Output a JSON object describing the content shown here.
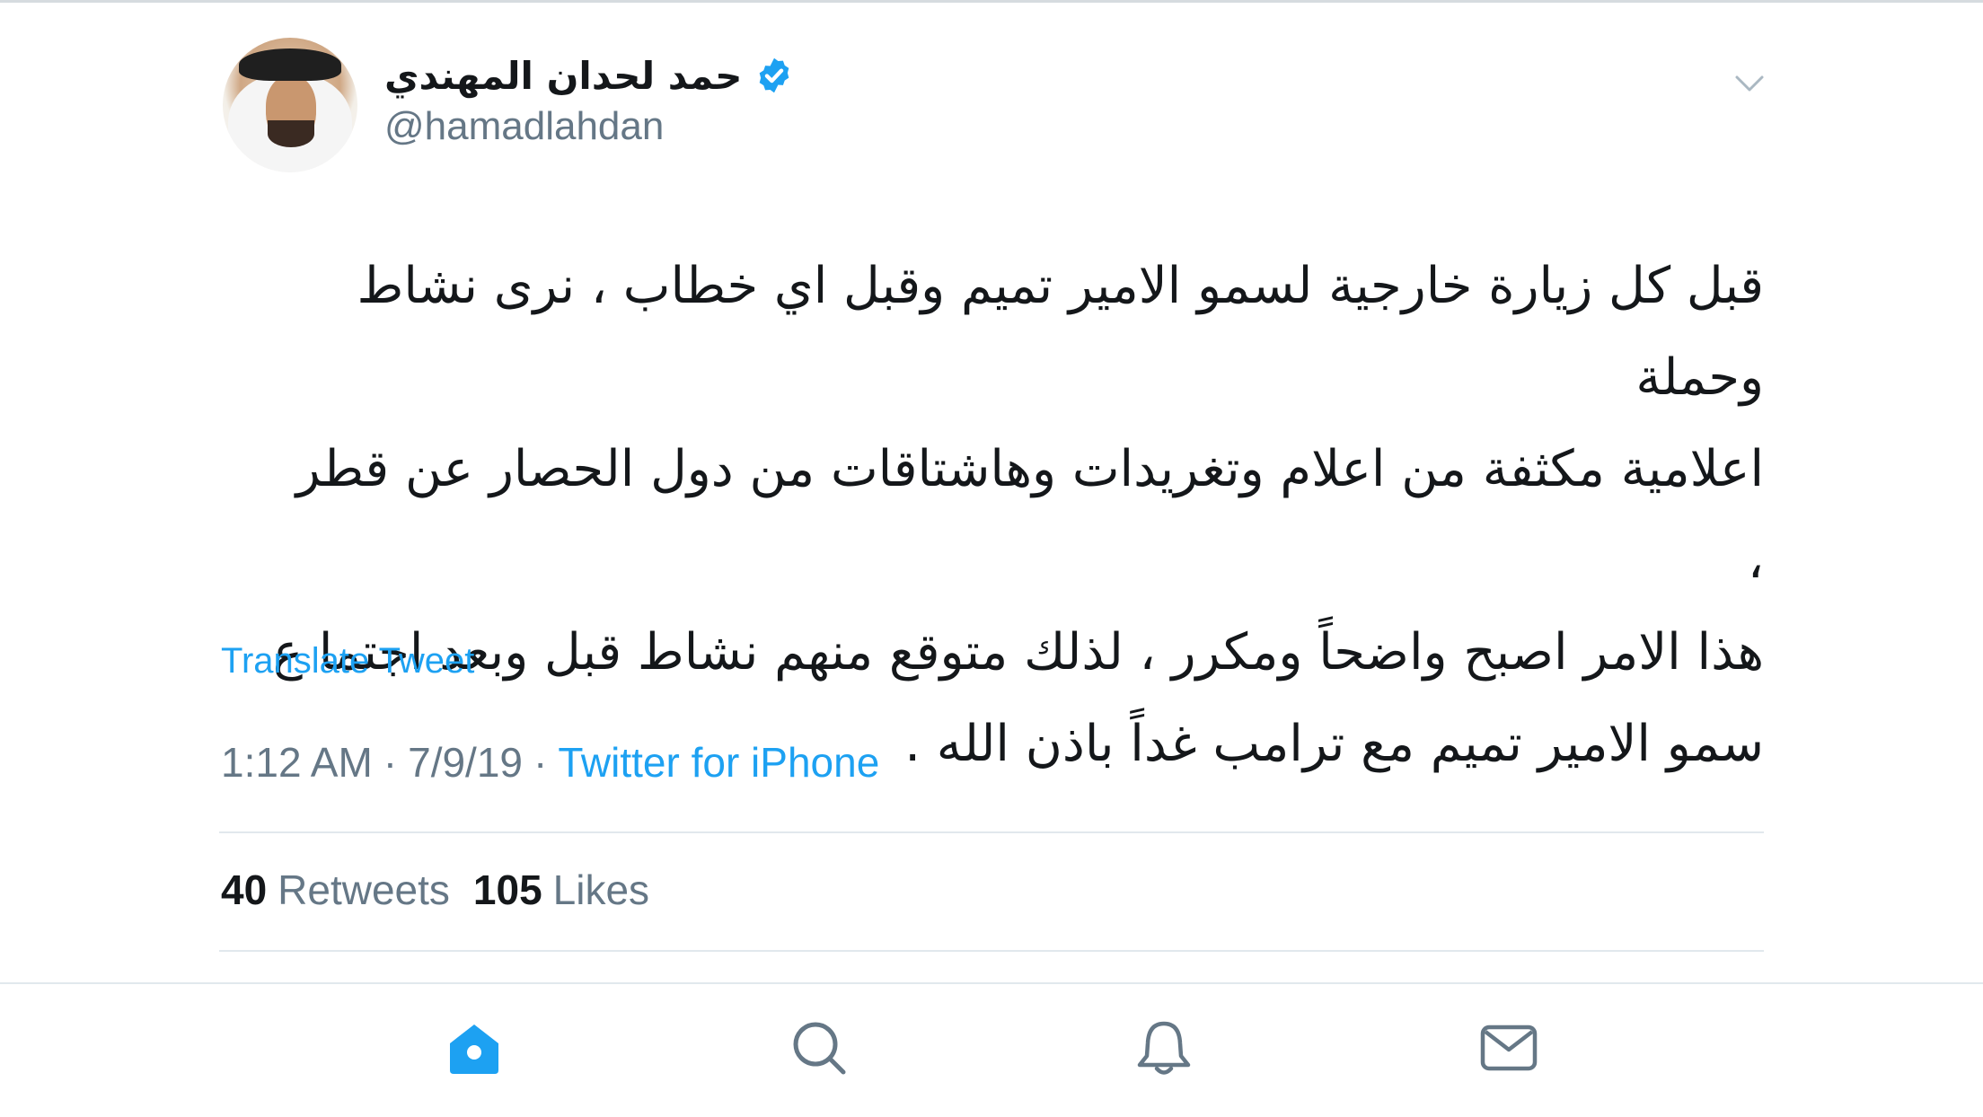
{
  "tweet": {
    "display_name": "حمد لحدان المهندي",
    "handle": "@hamadlahdan",
    "verified": true,
    "lines": [
      "قبل كل زيارة خارجية لسمو الامير تميم وقبل اي خطاب ، نرى نشاط وحملة",
      "اعلامية مكثفة من اعلام وتغريدات وهاشتاقات من دول الحصار عن قطر ،",
      "هذا الامر اصبح واضحاً ومكرر ، لذلك متوقع منهم نشاط قبل وبعد اجتما ع",
      "سمو الامير تميم مع ترامب غداً باذن الله ."
    ],
    "translate_label": "Translate Tweet",
    "time": "1:12 AM",
    "date": "7/9/19",
    "separator": "·",
    "source": "Twitter for iPhone",
    "retweets_count": "40",
    "retweets_label": "Retweets",
    "likes_count": "105",
    "likes_label": "Likes"
  },
  "tabbar": {
    "tabs": [
      {
        "icon": "home-icon",
        "active": true
      },
      {
        "icon": "search-icon",
        "active": false
      },
      {
        "icon": "bell-icon",
        "active": false
      },
      {
        "icon": "mail-icon",
        "active": false
      }
    ]
  },
  "colors": {
    "accent": "#1da1f2",
    "text_primary": "#14171a",
    "text_secondary": "#657786",
    "divider": "#e1e8ed",
    "icon_inactive": "#657786"
  }
}
